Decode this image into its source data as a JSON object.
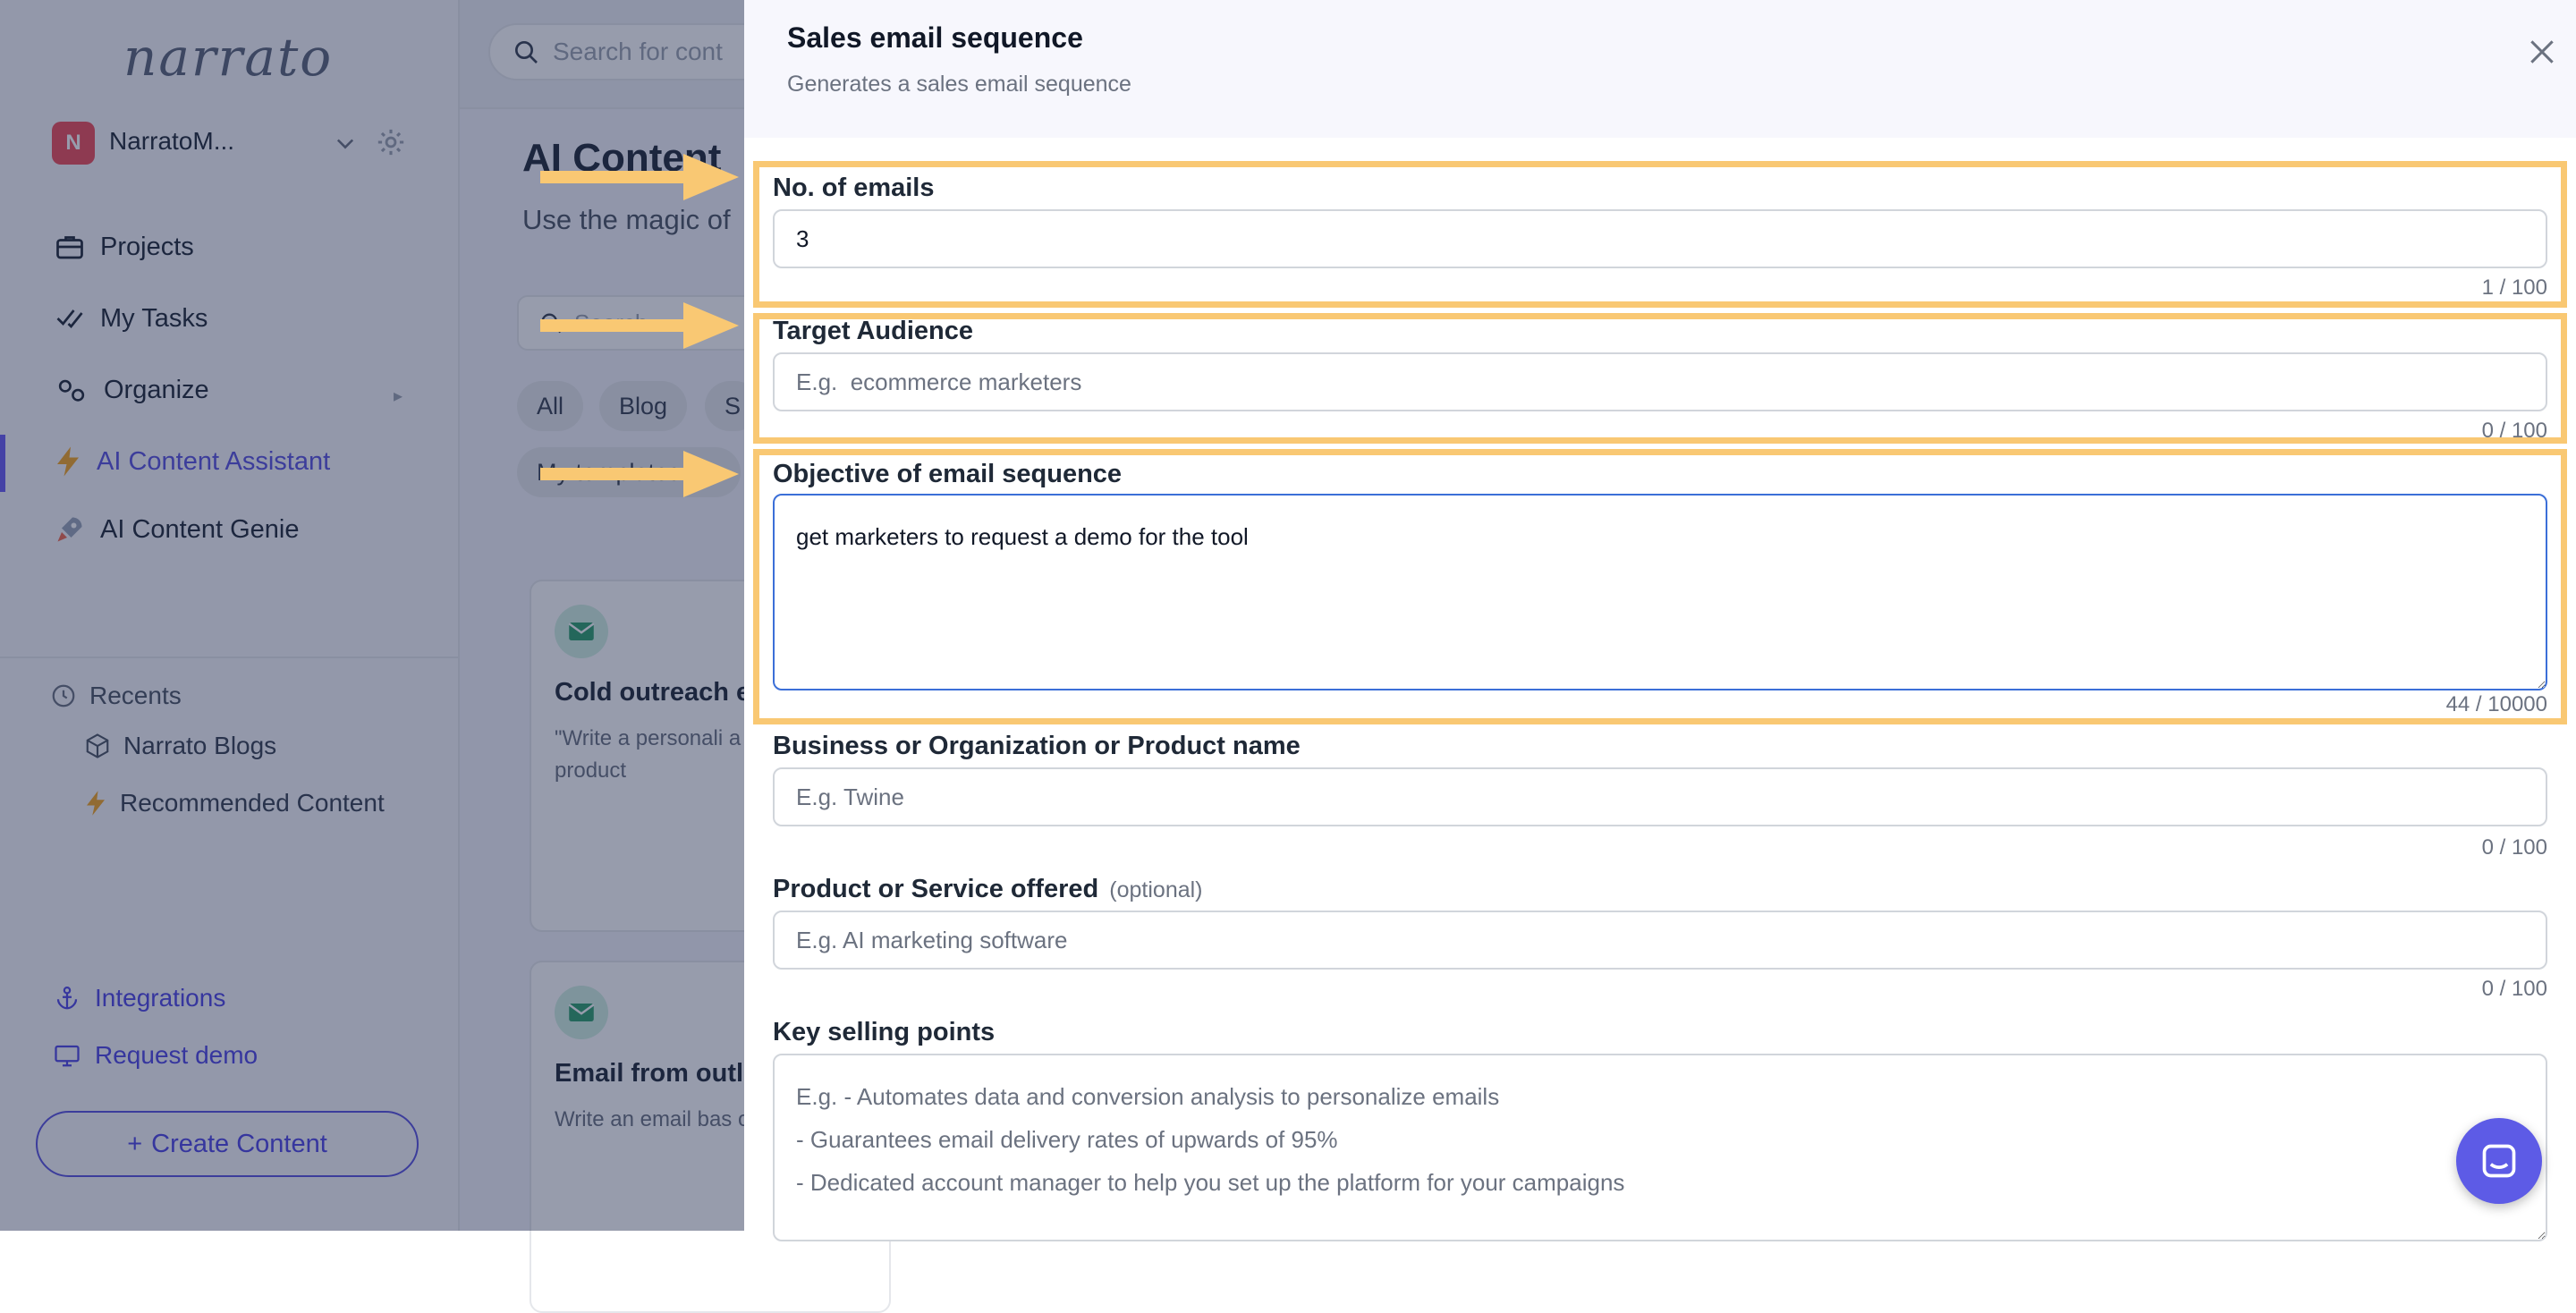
{
  "app": {
    "logo_text": "narrato",
    "workspace": {
      "initial": "N",
      "name": "NarratoM..."
    },
    "nav": [
      {
        "label": "Projects"
      },
      {
        "label": "My Tasks"
      },
      {
        "label": "Organize"
      },
      {
        "label": "AI Content Assistant"
      },
      {
        "label": "AI Content Genie"
      }
    ],
    "recents": {
      "heading": "Recents",
      "items": [
        {
          "label": "Narrato Blogs"
        },
        {
          "label": "Recommended Content"
        }
      ]
    },
    "footer": {
      "integrations": "Integrations",
      "request_demo": "Request demo",
      "create_content": "Create Content"
    },
    "search_placeholder": "Search for cont",
    "page_title": "AI Content",
    "page_subtitle": "Use the magic of",
    "filter_placeholder": "Search",
    "chips": [
      "All",
      "Blog",
      "S",
      "My templates"
    ],
    "cards": [
      {
        "title": "Cold outreach e",
        "desc": "\"Write a personali a specific product"
      },
      {
        "title": "Email from outli",
        "desc": "Write an email bas outline"
      }
    ]
  },
  "modal": {
    "title": "Sales email sequence",
    "subtitle": "Generates a sales email sequence",
    "fields": [
      {
        "label": "No. of emails",
        "value": "3",
        "placeholder": "",
        "counter": "1 / 100"
      },
      {
        "label": "Target Audience",
        "value": "",
        "placeholder": "E.g.  ecommerce marketers",
        "counter": "0 / 100"
      },
      {
        "label": "Objective of email sequence",
        "value": "get marketers to request a demo for the tool",
        "placeholder": "",
        "counter": "44 / 10000"
      },
      {
        "label": "Business or Organization or Product name",
        "value": "",
        "placeholder": "E.g. Twine",
        "counter": "0 / 100"
      },
      {
        "label": "Product or Service offered",
        "optional": "(optional)",
        "value": "",
        "placeholder": "E.g. AI marketing software",
        "counter": "0 / 100"
      },
      {
        "label": "Key selling points",
        "value": "",
        "placeholder": "E.g. - Automates data and conversion analysis to personalize emails\n- Guarantees email delivery rates of upwards of 95%\n- Dedicated account manager to help you set up the platform for your campaigns"
      }
    ]
  },
  "colors": {
    "accent": "#5a52e0",
    "highlight": "#f9c873",
    "chat": "#5d5be6"
  },
  "icons": [
    "briefcase-icon",
    "check-icon",
    "gears-icon",
    "bolt-icon",
    "rocket-icon",
    "clock-icon",
    "cube-icon",
    "anchor-icon",
    "monitor-icon",
    "close-icon",
    "chat-icon",
    "search-icon",
    "mail-icon",
    "arrow-icon"
  ]
}
